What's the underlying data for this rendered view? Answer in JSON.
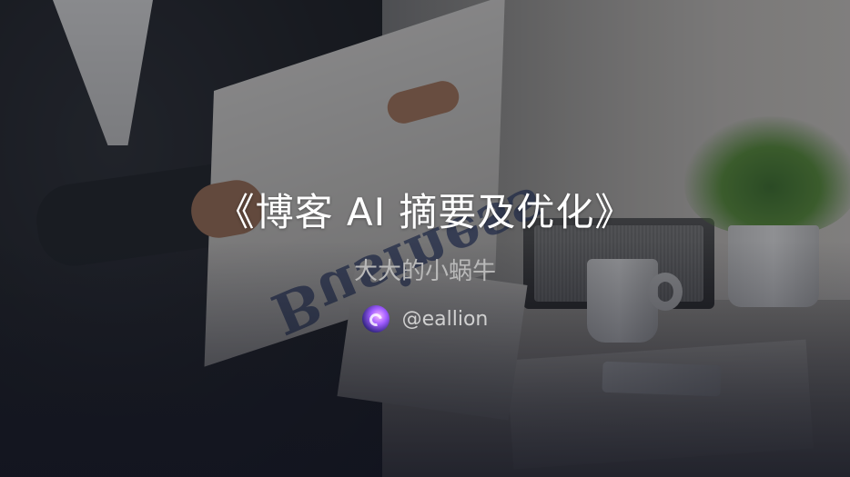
{
  "cover": {
    "title": "《博客 AI 摘要及优化》",
    "subtitle": "大大的小蜗牛",
    "author": {
      "handle": "@eallion",
      "avatar_icon": "snail-avatar-icon"
    },
    "newspaper_headline": "Business"
  },
  "colors": {
    "title": "#ffffff",
    "subtitle": "#b9b9b9",
    "handle": "#d0d0d0",
    "overlay": "#14161e"
  }
}
